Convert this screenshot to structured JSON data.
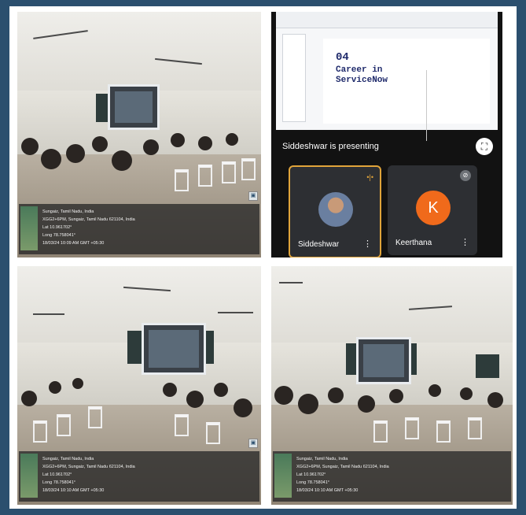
{
  "photos": [
    {
      "geotag": {
        "line1": "Sungaiz, Tamil Nadu, India",
        "line2": "XGG2+6PM, Sungaiz, Tamil Nadu 621104, India",
        "line3": "Lat 10.961702°",
        "line4": "Long 78.758041°",
        "line5": "18/03/24 10:09 AM GMT +05:30"
      }
    },
    {
      "geotag": {
        "line1": "Sungaiz, Tamil Nadu, India",
        "line2": "XGG2+6PM, Sungaiz, Tamil Nadu 621104, India",
        "line3": "Lat 10.961702°",
        "line4": "Long 78.758041°",
        "line5": "18/03/24 10:10 AM GMT +05:30"
      }
    },
    {
      "geotag": {
        "line1": "Sungaiz, Tamil Nadu, India",
        "line2": "XGG2+6PM, Sungaiz, Tamil Nadu 621104, India",
        "line3": "Lat 10.961702°",
        "line4": "Long 78.758041°",
        "line5": "18/03/24 10:10 AM GMT +05:30"
      }
    }
  ],
  "meet": {
    "slide_number": "04",
    "slide_title_1": "Career in",
    "slide_title_2": "ServiceNow",
    "presenting_text": "Siddeshwar is presenting",
    "participants": [
      {
        "name": "Siddeshwar"
      },
      {
        "name": "Keerthana",
        "initial": "K",
        "avatar_color": "#f06a1b"
      }
    ]
  },
  "colors": {
    "background": "#2b4f6e",
    "speaking_border": "#e0a43a"
  }
}
